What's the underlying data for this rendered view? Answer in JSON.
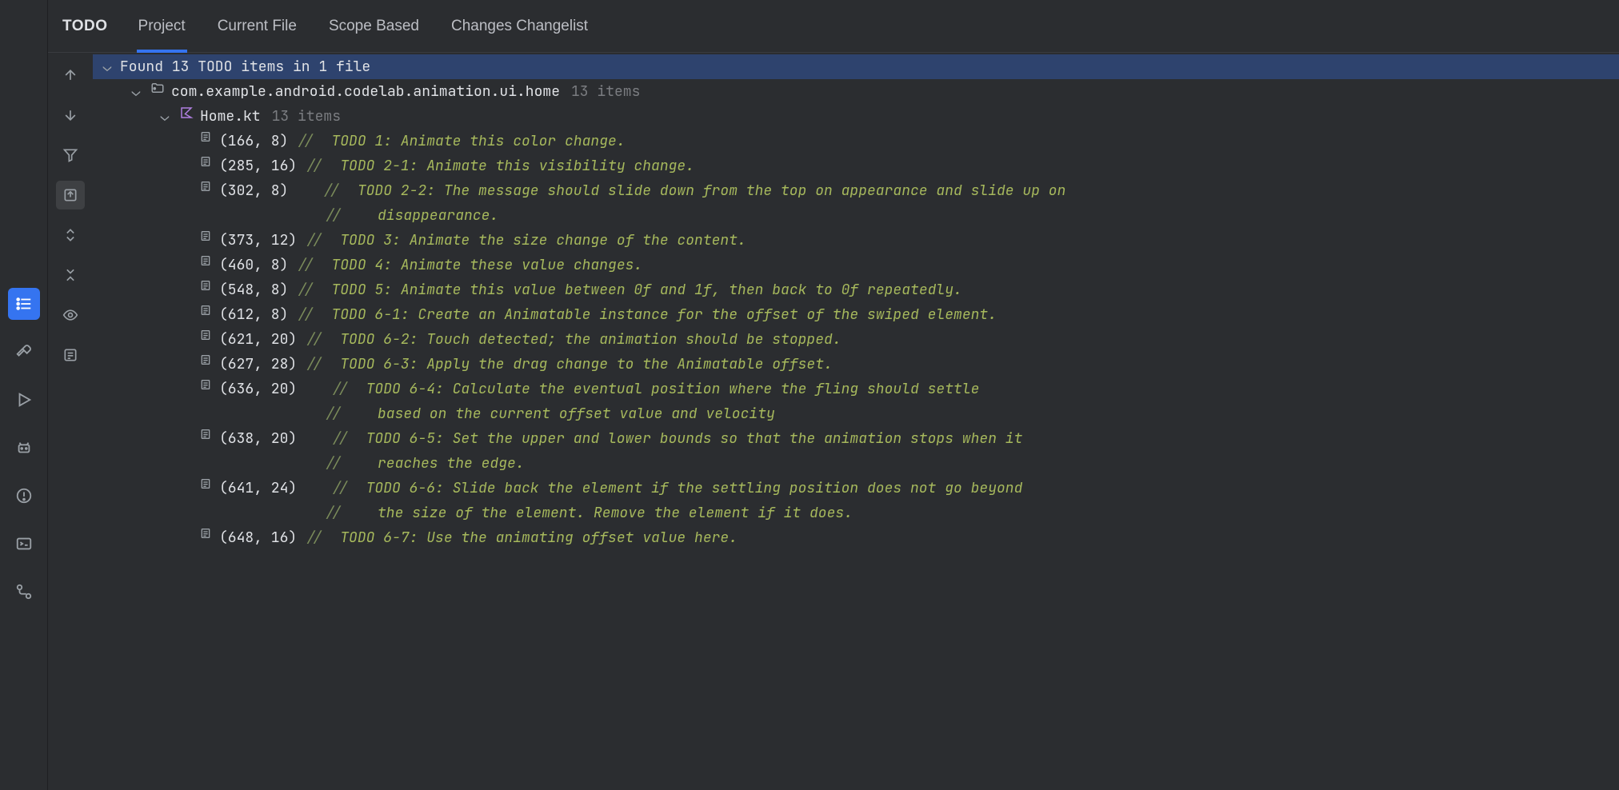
{
  "title": "TODO",
  "tabs": [
    "Project",
    "Current File",
    "Scope Based",
    "Changes Changelist"
  ],
  "activeTab": 0,
  "summary": "Found 13 TODO items in 1 file",
  "package": {
    "name": "com.example.android.codelab.animation.ui.home",
    "count": "13 items"
  },
  "file": {
    "name": "Home.kt",
    "count": "13 items"
  },
  "items": [
    {
      "loc": "(166, 8)",
      "lines": [
        "TODO 1: Animate this color change."
      ]
    },
    {
      "loc": "(285, 16)",
      "lines": [
        "TODO 2-1: Animate this visibility change."
      ]
    },
    {
      "loc": "(302, 8)",
      "indent": true,
      "lines": [
        "TODO 2-2: The message should slide down from the top on appearance and slide up on",
        "disappearance."
      ]
    },
    {
      "loc": "(373, 12)",
      "lines": [
        "TODO 3: Animate the size change of the content."
      ]
    },
    {
      "loc": "(460, 8)",
      "lines": [
        "TODO 4: Animate these value changes."
      ]
    },
    {
      "loc": "(548, 8)",
      "lines": [
        "TODO 5: Animate this value between 0f and 1f, then back to 0f repeatedly."
      ]
    },
    {
      "loc": "(612, 8)",
      "lines": [
        "TODO 6-1: Create an Animatable instance for the offset of the swiped element."
      ]
    },
    {
      "loc": "(621, 20)",
      "lines": [
        "TODO 6-2: Touch detected; the animation should be stopped."
      ]
    },
    {
      "loc": "(627, 28)",
      "lines": [
        "TODO 6-3: Apply the drag change to the Animatable offset."
      ]
    },
    {
      "loc": "(636, 20)",
      "indent": true,
      "lines": [
        "TODO 6-4: Calculate the eventual position where the fling should settle",
        "based on the current offset value and velocity"
      ]
    },
    {
      "loc": "(638, 20)",
      "indent": true,
      "lines": [
        "TODO 6-5: Set the upper and lower bounds so that the animation stops when it",
        "reaches the edge."
      ]
    },
    {
      "loc": "(641, 24)",
      "indent": true,
      "lines": [
        "TODO 6-6: Slide back the element if the settling position does not go beyond",
        "the size of the element. Remove the element if it does."
      ]
    },
    {
      "loc": "(648, 16)",
      "lines": [
        "TODO 6-7: Use the animating offset value here."
      ]
    }
  ]
}
